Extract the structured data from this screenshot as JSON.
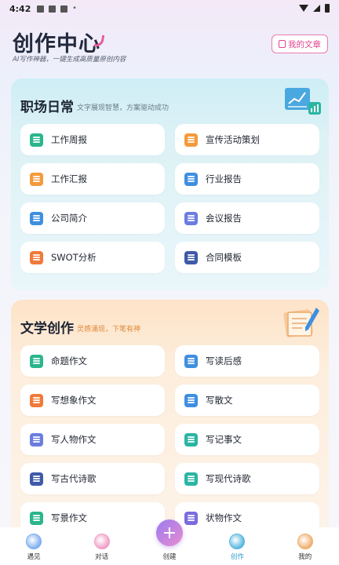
{
  "status_bar": {
    "time": "4:42"
  },
  "header": {
    "title": "创作中心",
    "subtitle": "AI写作神器，一键生成高质量原创内容",
    "my_articles_label": "我的文章"
  },
  "sections": [
    {
      "title": "职场日常",
      "subtitle": "文字展现智慧，方案驱动成功",
      "items": [
        {
          "label": "工作周报",
          "icon": "weekly-report-icon",
          "color": "#2bb58d"
        },
        {
          "label": "宣传活动策划",
          "icon": "campaign-plan-icon",
          "color": "#f49a3c"
        },
        {
          "label": "工作汇报",
          "icon": "work-report-icon",
          "color": "#f49a3c"
        },
        {
          "label": "行业报告",
          "icon": "industry-report-icon",
          "color": "#3f8fe0"
        },
        {
          "label": "公司简介",
          "icon": "company-profile-icon",
          "color": "#3f8fe0"
        },
        {
          "label": "会议报告",
          "icon": "meeting-report-icon",
          "color": "#6b7de0"
        },
        {
          "label": "SWOT分析",
          "icon": "swot-icon",
          "color": "#f07a3a"
        },
        {
          "label": "合同模板",
          "icon": "contract-icon",
          "color": "#3e5aa8"
        }
      ]
    },
    {
      "title": "文学创作",
      "subtitle": "灵感涌现，下笔有神",
      "items": [
        {
          "label": "命题作文",
          "icon": "topic-essay-icon",
          "color": "#2bb58d"
        },
        {
          "label": "写读后感",
          "icon": "reading-note-icon",
          "color": "#3f8fe0"
        },
        {
          "label": "写想象作文",
          "icon": "imagination-essay-icon",
          "color": "#f07a3a"
        },
        {
          "label": "写散文",
          "icon": "prose-icon",
          "color": "#3f8fe0"
        },
        {
          "label": "写人物作文",
          "icon": "character-essay-icon",
          "color": "#6b7de0"
        },
        {
          "label": "写记事文",
          "icon": "narrative-icon",
          "color": "#2bb5a3"
        },
        {
          "label": "写古代诗歌",
          "icon": "classical-poem-icon",
          "color": "#3e5aa8"
        },
        {
          "label": "写现代诗歌",
          "icon": "modern-poem-icon",
          "color": "#2bb5a3"
        },
        {
          "label": "写景作文",
          "icon": "scenery-essay-icon",
          "color": "#2bb58d"
        },
        {
          "label": "状物作文",
          "icon": "object-essay-icon",
          "color": "#7a6be0"
        }
      ]
    }
  ],
  "bottom_nav": {
    "items": [
      {
        "label": "遇见",
        "icon": "planet-icon",
        "color": "#7fb0f0"
      },
      {
        "label": "对话",
        "icon": "chat-icon",
        "color": "#f0a0c8"
      },
      {
        "label": "创建",
        "icon": "plus-icon",
        "color": "#b48cf0"
      },
      {
        "label": "创作",
        "icon": "feather-icon",
        "color": "#5ab8e0"
      },
      {
        "label": "我的",
        "icon": "profile-icon",
        "color": "#f0b070"
      }
    ],
    "fab_symbol": "+"
  }
}
